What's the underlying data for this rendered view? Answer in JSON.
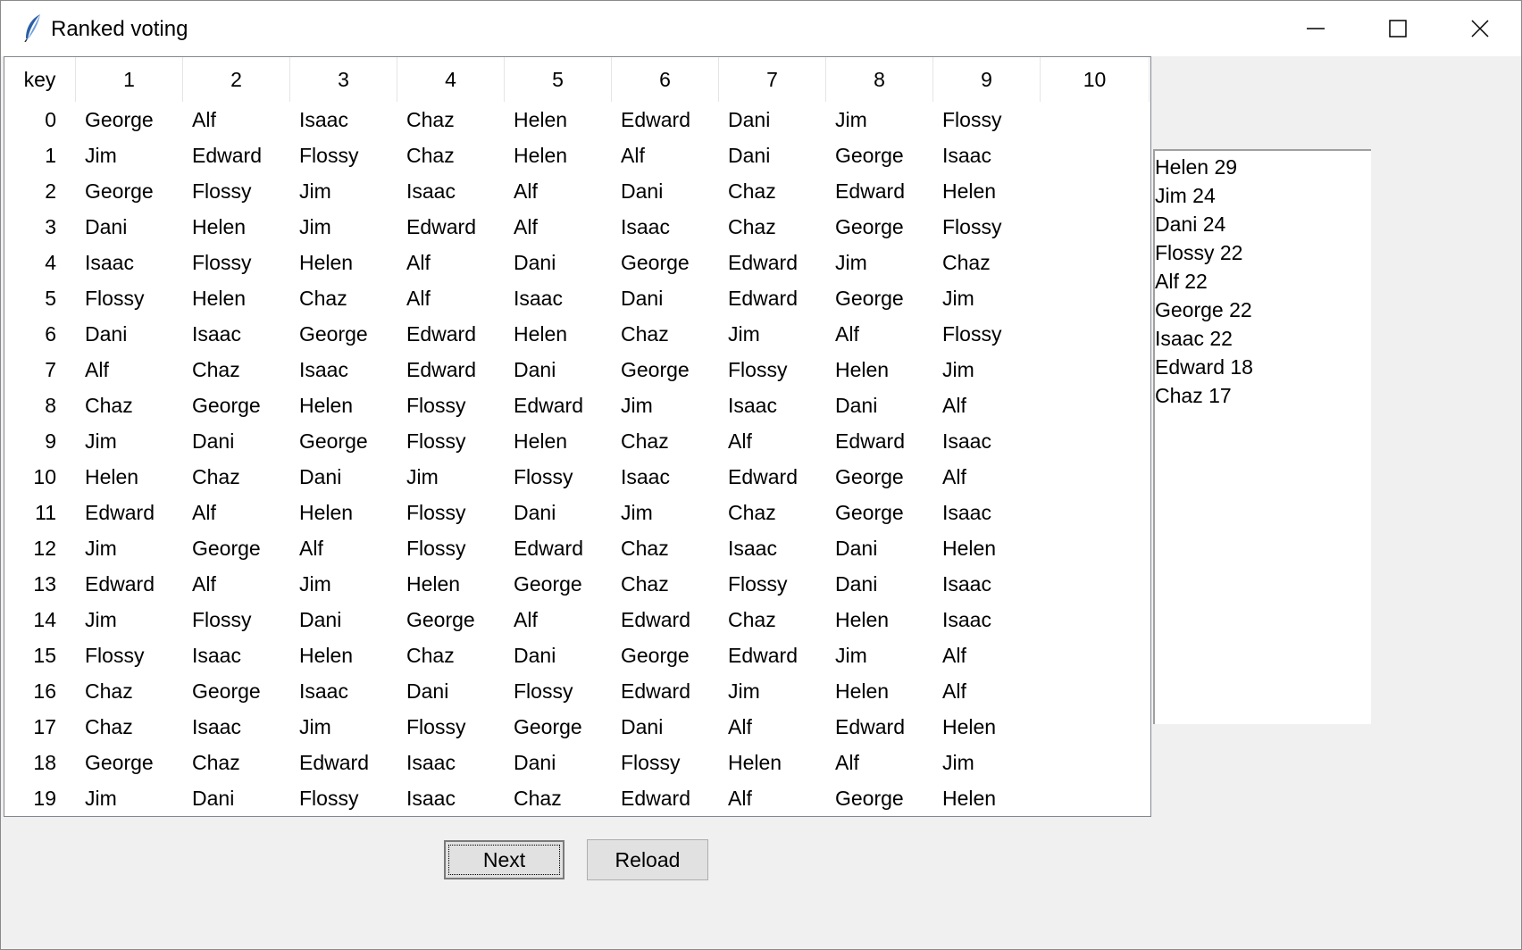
{
  "window": {
    "title": "Ranked voting",
    "icon": "feather-icon",
    "controls": [
      "minimize-icon",
      "maximize-icon",
      "close-icon"
    ]
  },
  "table": {
    "headers": [
      "key",
      "1",
      "2",
      "3",
      "4",
      "5",
      "6",
      "7",
      "8",
      "9",
      "10"
    ],
    "rows": [
      [
        "0",
        "George",
        "Alf",
        "Isaac",
        "Chaz",
        "Helen",
        "Edward",
        "Dani",
        "Jim",
        "Flossy",
        ""
      ],
      [
        "1",
        "Jim",
        "Edward",
        "Flossy",
        "Chaz",
        "Helen",
        "Alf",
        "Dani",
        "George",
        "Isaac",
        ""
      ],
      [
        "2",
        "George",
        "Flossy",
        "Jim",
        "Isaac",
        "Alf",
        "Dani",
        "Chaz",
        "Edward",
        "Helen",
        ""
      ],
      [
        "3",
        "Dani",
        "Helen",
        "Jim",
        "Edward",
        "Alf",
        "Isaac",
        "Chaz",
        "George",
        "Flossy",
        ""
      ],
      [
        "4",
        "Isaac",
        "Flossy",
        "Helen",
        "Alf",
        "Dani",
        "George",
        "Edward",
        "Jim",
        "Chaz",
        ""
      ],
      [
        "5",
        "Flossy",
        "Helen",
        "Chaz",
        "Alf",
        "Isaac",
        "Dani",
        "Edward",
        "George",
        "Jim",
        ""
      ],
      [
        "6",
        "Dani",
        "Isaac",
        "George",
        "Edward",
        "Helen",
        "Chaz",
        "Jim",
        "Alf",
        "Flossy",
        ""
      ],
      [
        "7",
        "Alf",
        "Chaz",
        "Isaac",
        "Edward",
        "Dani",
        "George",
        "Flossy",
        "Helen",
        "Jim",
        ""
      ],
      [
        "8",
        "Chaz",
        "George",
        "Helen",
        "Flossy",
        "Edward",
        "Jim",
        "Isaac",
        "Dani",
        "Alf",
        ""
      ],
      [
        "9",
        "Jim",
        "Dani",
        "George",
        "Flossy",
        "Helen",
        "Chaz",
        "Alf",
        "Edward",
        "Isaac",
        ""
      ],
      [
        "10",
        "Helen",
        "Chaz",
        "Dani",
        "Jim",
        "Flossy",
        "Isaac",
        "Edward",
        "George",
        "Alf",
        ""
      ],
      [
        "11",
        "Edward",
        "Alf",
        "Helen",
        "Flossy",
        "Dani",
        "Jim",
        "Chaz",
        "George",
        "Isaac",
        ""
      ],
      [
        "12",
        "Jim",
        "George",
        "Alf",
        "Flossy",
        "Edward",
        "Chaz",
        "Isaac",
        "Dani",
        "Helen",
        ""
      ],
      [
        "13",
        "Edward",
        "Alf",
        "Jim",
        "Helen",
        "George",
        "Chaz",
        "Flossy",
        "Dani",
        "Isaac",
        ""
      ],
      [
        "14",
        "Jim",
        "Flossy",
        "Dani",
        "George",
        "Alf",
        "Edward",
        "Chaz",
        "Helen",
        "Isaac",
        ""
      ],
      [
        "15",
        "Flossy",
        "Isaac",
        "Helen",
        "Chaz",
        "Dani",
        "George",
        "Edward",
        "Jim",
        "Alf",
        ""
      ],
      [
        "16",
        "Chaz",
        "George",
        "Isaac",
        "Dani",
        "Flossy",
        "Edward",
        "Jim",
        "Helen",
        "Alf",
        ""
      ],
      [
        "17",
        "Chaz",
        "Isaac",
        "Jim",
        "Flossy",
        "George",
        "Dani",
        "Alf",
        "Edward",
        "Helen",
        ""
      ],
      [
        "18",
        "George",
        "Chaz",
        "Edward",
        "Isaac",
        "Dani",
        "Flossy",
        "Helen",
        "Alf",
        "Jim",
        ""
      ],
      [
        "19",
        "Jim",
        "Dani",
        "Flossy",
        "Isaac",
        "Chaz",
        "Edward",
        "Alf",
        "George",
        "Helen",
        ""
      ]
    ]
  },
  "results": [
    "Helen 29",
    "Jim 24",
    "Dani 24",
    "Flossy 22",
    "Alf 22",
    "George 22",
    "Isaac 22",
    "Edward 18",
    "Chaz 17"
  ],
  "buttons": {
    "next": "Next",
    "reload": "Reload"
  }
}
